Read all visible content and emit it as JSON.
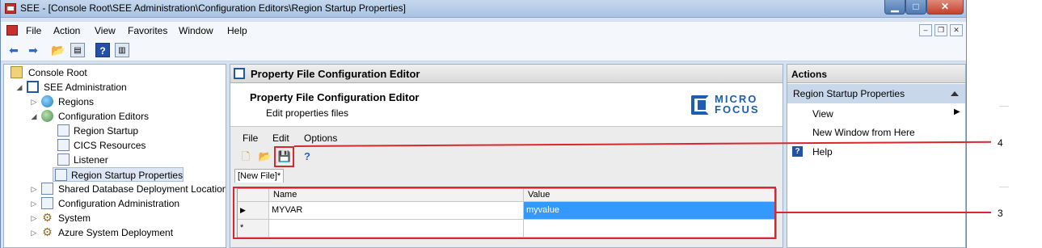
{
  "window": {
    "title": "SEE - [Console Root\\SEE Administration\\Configuration Editors\\Region Startup Properties]",
    "min_label": "▁",
    "max_label": "□",
    "close_label": "✕"
  },
  "menu": {
    "items": [
      "File",
      "Action",
      "View",
      "Favorites",
      "Window",
      "Help"
    ],
    "mdi": [
      "–",
      "❐",
      "✕"
    ]
  },
  "tree": {
    "nodes": [
      {
        "label": "Console Root"
      },
      {
        "label": "SEE Administration"
      },
      {
        "label": "Regions"
      },
      {
        "label": "Configuration Editors"
      },
      {
        "label": "Region Startup"
      },
      {
        "label": "CICS Resources"
      },
      {
        "label": "Listener"
      },
      {
        "label": "Region Startup Properties"
      },
      {
        "label": "Shared Database Deployment Locations"
      },
      {
        "label": "Configuration Administration"
      },
      {
        "label": "System"
      },
      {
        "label": "Azure System Deployment"
      }
    ]
  },
  "center": {
    "header": "Property File Configuration Editor",
    "title": "Property File Configuration Editor",
    "subtitle": "Edit properties files",
    "logo_line1": "MICRO",
    "logo_line2": "FOCUS",
    "editor_menus": [
      "File",
      "Edit",
      "Options"
    ],
    "tab": "[New File]*",
    "grid": {
      "columns": [
        "Name",
        "Value"
      ],
      "rows": [
        {
          "marker": "▶",
          "name": "MYVAR",
          "value": "myvalue"
        },
        {
          "marker": "*",
          "name": "",
          "value": ""
        }
      ]
    }
  },
  "actions": {
    "title": "Actions",
    "section": "Region Startup Properties",
    "items": [
      "View",
      "New Window from Here",
      "Help"
    ]
  },
  "callouts": [
    "4",
    "3"
  ],
  "colors": {
    "highlight": "#d9272e",
    "selection": "#3399ff",
    "brand": "#1b5fb0"
  }
}
